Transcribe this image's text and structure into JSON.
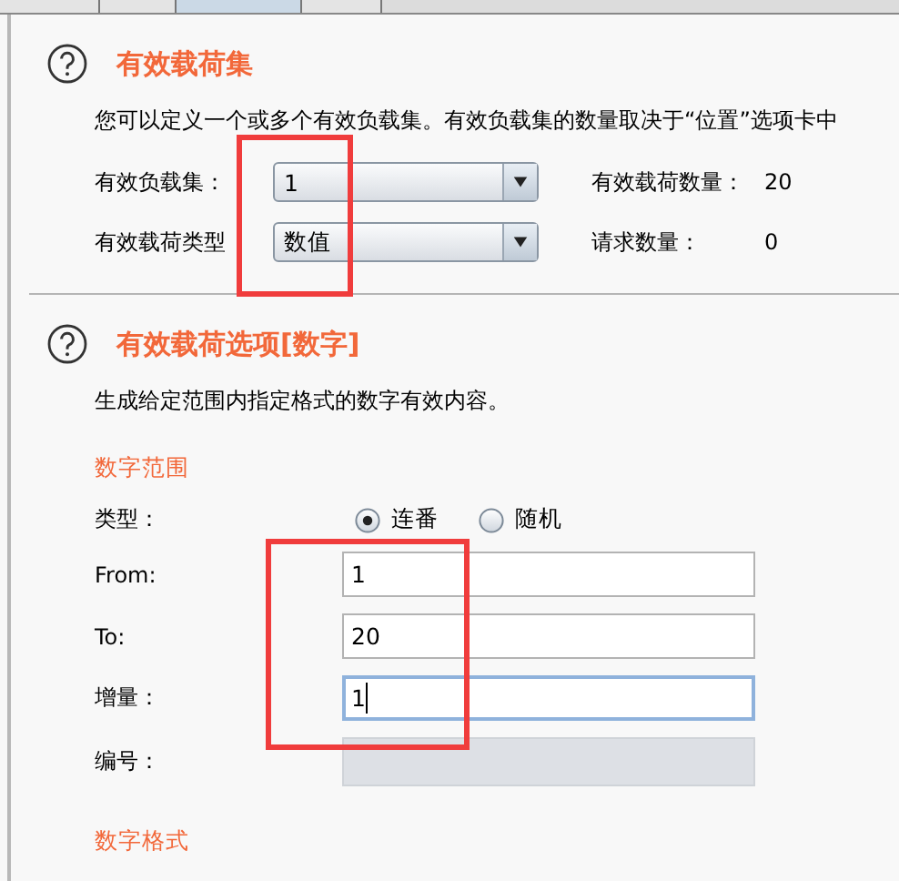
{
  "tabs": [
    {
      "selected": false
    },
    {
      "selected": false
    },
    {
      "selected": true
    },
    {
      "selected": false
    }
  ],
  "payload_sets": {
    "title": "有效载荷集",
    "description": "您可以定义一个或多个有效负载集。有效负载集的数量取决于“位置”选项卡中",
    "rows": [
      {
        "label": "有效负载集：",
        "combo": "1",
        "info_label": "有效载荷数量：",
        "info_value": "20"
      },
      {
        "label": "有效载荷类型",
        "combo": "数值",
        "info_label": "请求数量：",
        "info_value": "0"
      }
    ]
  },
  "payload_options": {
    "title": "有效载荷选项[数字]",
    "description": "生成给定范围内指定格式的数字有效内容。",
    "range_heading": "数字范围",
    "type_label": "类型：",
    "type_options": [
      {
        "label": "连番",
        "selected": true
      },
      {
        "label": "随机",
        "selected": false
      }
    ],
    "fields": [
      {
        "label": "From:",
        "value": "1",
        "focused": false,
        "disabled": false
      },
      {
        "label": "To:",
        "value": "20",
        "focused": false,
        "disabled": false
      },
      {
        "label": "增量：",
        "value": "1",
        "focused": true,
        "disabled": false
      },
      {
        "label": "编号：",
        "focused": false,
        "disabled": true
      }
    ],
    "format_heading": "数字格式"
  }
}
